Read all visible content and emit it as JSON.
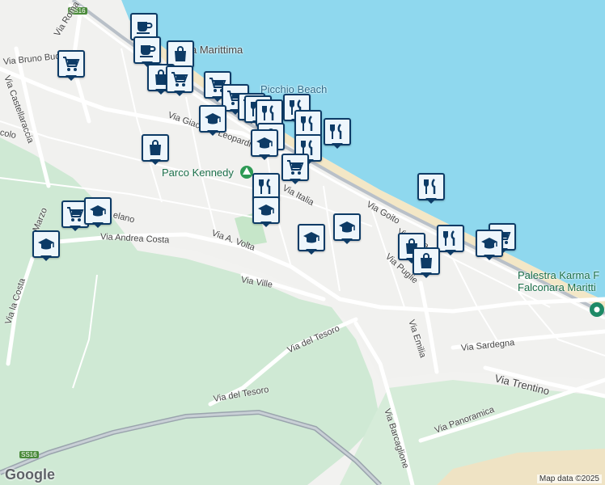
{
  "map": {
    "attribution": "Map data ©2025",
    "logo": "Google",
    "highway_shields": [
      "SS16",
      "SS16"
    ],
    "street_labels": [
      {
        "text": "Via Bruno Buozzi",
        "name": "street-via-bruno-buozzi"
      },
      {
        "text": "Via Roma",
        "name": "street-via-roma"
      },
      {
        "text": "Via Castellaraccia",
        "name": "street-via-castellaraccia"
      },
      {
        "text": "colo",
        "name": "street-colo"
      },
      {
        "text": "Via Giacomo Leopardi",
        "name": "street-via-giacomo-leopardi"
      },
      {
        "text": "Via Italia",
        "name": "street-via-italia"
      },
      {
        "text": "Via Italia",
        "name": "street-via-italia-2"
      },
      {
        "text": "Via Goito",
        "name": "street-via-goito"
      },
      {
        "text": "Via Puglie",
        "name": "street-via-puglie"
      },
      {
        "text": "Via Andrea Costa",
        "name": "street-via-andrea-costa"
      },
      {
        "text": "Via A. Volta",
        "name": "street-via-a-volta"
      },
      {
        "text": "Via Ville",
        "name": "street-via-ville"
      },
      {
        "text": "Via del Tesoro",
        "name": "street-via-del-tesoro"
      },
      {
        "text": "Via del Tesoro",
        "name": "street-via-del-tesoro-2"
      },
      {
        "text": "Via la Costa",
        "name": "street-via-la-costa"
      },
      {
        "text": "Marzo",
        "name": "street-marzo"
      },
      {
        "text": "elano",
        "name": "street-elano"
      },
      {
        "text": "Via Emilia",
        "name": "street-via-emilia"
      },
      {
        "text": "Via Sardegna",
        "name": "street-via-sardegna"
      },
      {
        "text": "Via Trentino",
        "name": "street-via-trentino"
      },
      {
        "text": "Via Barcaglione",
        "name": "street-via-barcaglione"
      },
      {
        "text": "Via Panoramica",
        "name": "street-via-panoramica"
      }
    ],
    "places": {
      "parco": "Parco Kennedy",
      "beach": "Picchio Beach",
      "marittima": "a Marittima",
      "palestra_line1": "Palestra Karma F",
      "palestra_line2": "Falconara Maritti"
    },
    "markers": [
      {
        "icon": "cup"
      },
      {
        "icon": "cup"
      },
      {
        "icon": "bag"
      },
      {
        "icon": "cart"
      },
      {
        "icon": "bag"
      },
      {
        "icon": "cart"
      },
      {
        "icon": "cart"
      },
      {
        "icon": "cart"
      },
      {
        "icon": "cart"
      },
      {
        "icon": "fork"
      },
      {
        "icon": "fork"
      },
      {
        "icon": "fork"
      },
      {
        "icon": "grad"
      },
      {
        "icon": "bag"
      },
      {
        "icon": "fork"
      },
      {
        "icon": "fork"
      },
      {
        "icon": "fork"
      },
      {
        "icon": "bag"
      },
      {
        "icon": "cart"
      },
      {
        "icon": "fork"
      },
      {
        "icon": "grad"
      },
      {
        "icon": "grad"
      },
      {
        "icon": "grad"
      },
      {
        "icon": "cart"
      },
      {
        "icon": "grad"
      },
      {
        "icon": "grad"
      },
      {
        "icon": "fork"
      },
      {
        "icon": "bag"
      },
      {
        "icon": "fork"
      },
      {
        "icon": "bag"
      },
      {
        "icon": "cart"
      },
      {
        "icon": "grad"
      },
      {
        "icon": "grad"
      }
    ]
  }
}
